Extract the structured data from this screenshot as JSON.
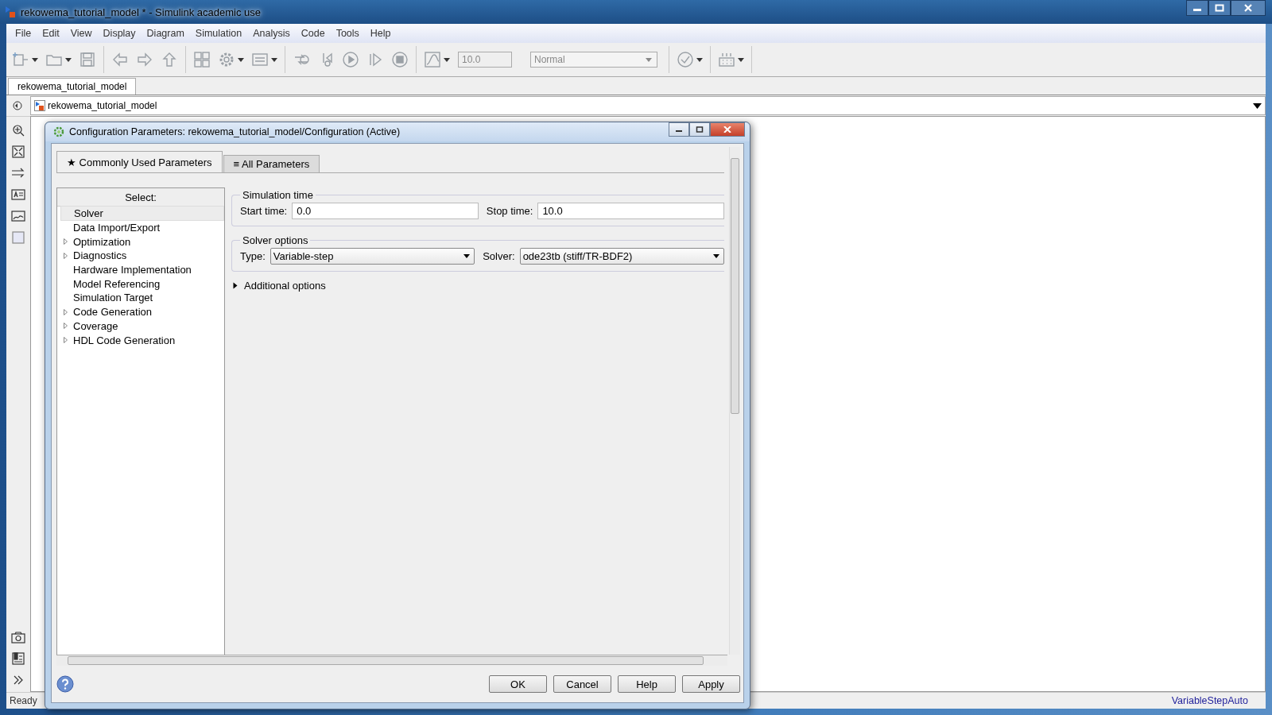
{
  "window": {
    "title": "rekowema_tutorial_model * - Simulink academic use"
  },
  "menu": [
    "File",
    "Edit",
    "View",
    "Display",
    "Diagram",
    "Simulation",
    "Analysis",
    "Code",
    "Tools",
    "Help"
  ],
  "toolbar": [
    [
      {
        "kind": "new",
        "menu": true
      },
      {
        "kind": "open",
        "menu": true
      },
      {
        "kind": "save",
        "menu": false
      }
    ],
    [
      {
        "kind": "back",
        "menu": false
      },
      {
        "kind": "forward",
        "menu": false
      },
      {
        "kind": "up",
        "menu": false
      }
    ],
    [
      {
        "kind": "library",
        "menu": false
      },
      {
        "kind": "gear",
        "menu": true
      },
      {
        "kind": "explorer",
        "menu": true
      }
    ],
    [
      {
        "kind": "update",
        "menu": false
      },
      {
        "kind": "stepback",
        "menu": false
      },
      {
        "kind": "run",
        "menu": false
      },
      {
        "kind": "stepforward",
        "menu": false
      },
      {
        "kind": "stop",
        "menu": false
      }
    ],
    [
      {
        "kind": "scope",
        "menu": true
      }
    ]
  ],
  "stop_time": "10.0",
  "sim_mode": "Normal",
  "toolbar_right": [
    {
      "kind": "check",
      "menu": true
    },
    {
      "kind": "grid",
      "menu": true
    }
  ],
  "model_tab": {
    "label": "rekowema_tutorial_model",
    "selected": true
  },
  "breadcrumb": "rekowema_tutorial_model",
  "palette_top": [
    {
      "kind": "zoom"
    },
    {
      "kind": "fit"
    },
    {
      "kind": "arrows"
    },
    {
      "kind": "annotation"
    },
    {
      "kind": "image"
    },
    {
      "kind": "area"
    }
  ],
  "palette_bottom": [
    {
      "kind": "camera"
    },
    {
      "kind": "report"
    },
    {
      "kind": "more"
    }
  ],
  "dialog": {
    "title": "Configuration Parameters: rekowema_tutorial_model/Configuration (Active)",
    "tabs": [
      {
        "icon": "★",
        "label": "Commonly Used Parameters",
        "selected": true
      },
      {
        "icon": "≡",
        "label": "All Parameters",
        "selected": false
      }
    ],
    "select_header": "Select:",
    "tree": [
      {
        "label": "Solver",
        "expandable": false,
        "selected": true
      },
      {
        "label": "Data Import/Export",
        "expandable": false,
        "selected": false
      },
      {
        "label": "Optimization",
        "expandable": true,
        "selected": false
      },
      {
        "label": "Diagnostics",
        "expandable": true,
        "selected": false
      },
      {
        "label": "Hardware Implementation",
        "expandable": false,
        "selected": false
      },
      {
        "label": "Model Referencing",
        "expandable": false,
        "selected": false
      },
      {
        "label": "Simulation Target",
        "expandable": false,
        "selected": false
      },
      {
        "label": "Code Generation",
        "expandable": true,
        "selected": false
      },
      {
        "label": "Coverage",
        "expandable": true,
        "selected": false
      },
      {
        "label": "HDL Code Generation",
        "expandable": true,
        "selected": false
      }
    ],
    "sim_time": {
      "title": "Simulation time",
      "start_label": "Start time:",
      "start_value": "0.0",
      "stop_label": "Stop time:",
      "stop_value": "10.0"
    },
    "solver_options": {
      "title": "Solver options",
      "type_label": "Type:",
      "type_value": "Variable-step",
      "solver_label": "Solver:",
      "solver_value": "ode23tb (stiff/TR-BDF2)"
    },
    "additional": {
      "label": "Additional options",
      "expanded": false
    },
    "buttons": [
      "OK",
      "Cancel",
      "Help",
      "Apply"
    ]
  },
  "status_bar": {
    "left": "Ready",
    "right": "VariableStepAuto"
  }
}
